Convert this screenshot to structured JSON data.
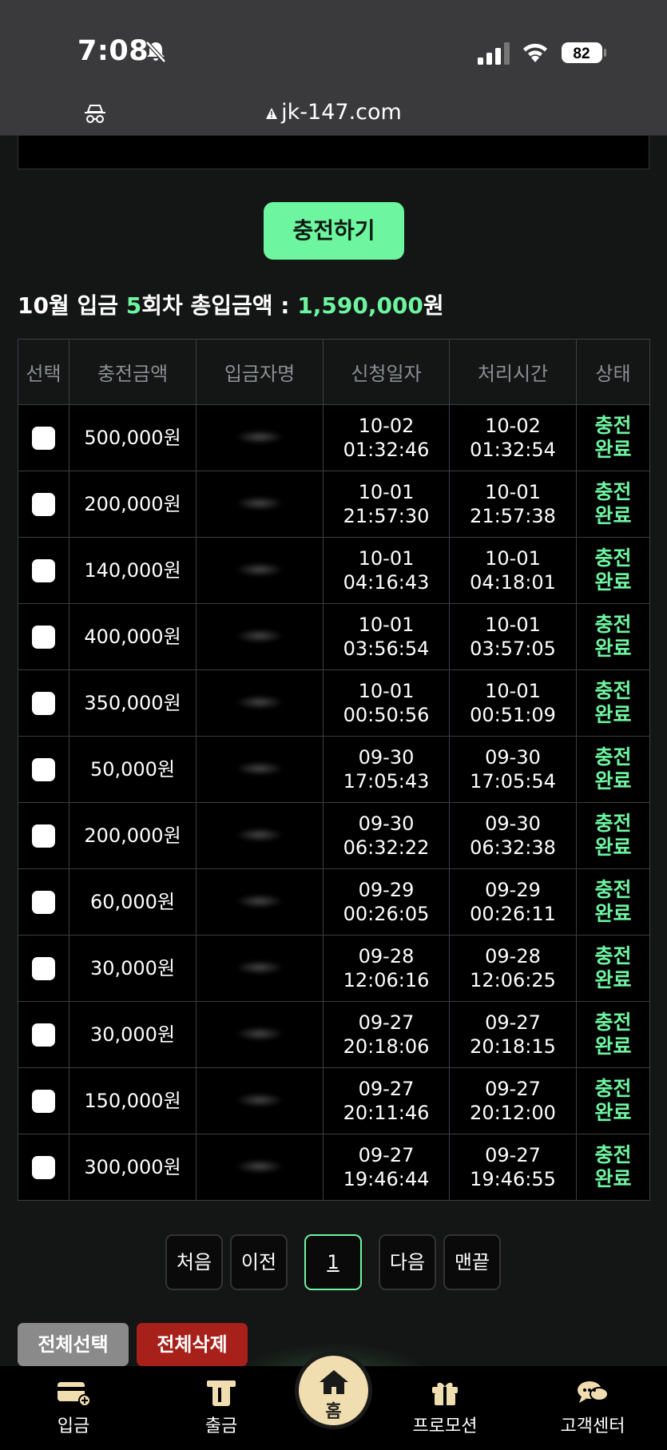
{
  "status_bar": {
    "time": "7:08",
    "battery": "82"
  },
  "browser": {
    "url": "jk-147.com"
  },
  "charge_button": "충전하기",
  "summary": {
    "prefix": "10월 입금 ",
    "count": "5",
    "mid": "회차 총입금액 : ",
    "amount": "1,590,000",
    "suffix": "원"
  },
  "table": {
    "headers": [
      "선택",
      "충전금액",
      "입금자명",
      "신청일자",
      "처리시간",
      "상태"
    ],
    "rows": [
      {
        "amount": "500,000원",
        "req_date": "10-02",
        "req_time": "01:32:46",
        "proc_date": "10-02",
        "proc_time": "01:32:54",
        "status1": "충전",
        "status2": "완료"
      },
      {
        "amount": "200,000원",
        "req_date": "10-01",
        "req_time": "21:57:30",
        "proc_date": "10-01",
        "proc_time": "21:57:38",
        "status1": "충전",
        "status2": "완료"
      },
      {
        "amount": "140,000원",
        "req_date": "10-01",
        "req_time": "04:16:43",
        "proc_date": "10-01",
        "proc_time": "04:18:01",
        "status1": "충전",
        "status2": "완료"
      },
      {
        "amount": "400,000원",
        "req_date": "10-01",
        "req_time": "03:56:54",
        "proc_date": "10-01",
        "proc_time": "03:57:05",
        "status1": "충전",
        "status2": "완료"
      },
      {
        "amount": "350,000원",
        "req_date": "10-01",
        "req_time": "00:50:56",
        "proc_date": "10-01",
        "proc_time": "00:51:09",
        "status1": "충전",
        "status2": "완료"
      },
      {
        "amount": "50,000원",
        "req_date": "09-30",
        "req_time": "17:05:43",
        "proc_date": "09-30",
        "proc_time": "17:05:54",
        "status1": "충전",
        "status2": "완료"
      },
      {
        "amount": "200,000원",
        "req_date": "09-30",
        "req_time": "06:32:22",
        "proc_date": "09-30",
        "proc_time": "06:32:38",
        "status1": "충전",
        "status2": "완료"
      },
      {
        "amount": "60,000원",
        "req_date": "09-29",
        "req_time": "00:26:05",
        "proc_date": "09-29",
        "proc_time": "00:26:11",
        "status1": "충전",
        "status2": "완료"
      },
      {
        "amount": "30,000원",
        "req_date": "09-28",
        "req_time": "12:06:16",
        "proc_date": "09-28",
        "proc_time": "12:06:25",
        "status1": "충전",
        "status2": "완료"
      },
      {
        "amount": "30,000원",
        "req_date": "09-27",
        "req_time": "20:18:06",
        "proc_date": "09-27",
        "proc_time": "20:18:15",
        "status1": "충전",
        "status2": "완료"
      },
      {
        "amount": "150,000원",
        "req_date": "09-27",
        "req_time": "20:11:46",
        "proc_date": "09-27",
        "proc_time": "20:12:00",
        "status1": "충전",
        "status2": "완료"
      },
      {
        "amount": "300,000원",
        "req_date": "09-27",
        "req_time": "19:46:44",
        "proc_date": "09-27",
        "proc_time": "19:46:55",
        "status1": "충전",
        "status2": "완료"
      }
    ]
  },
  "pagination": {
    "first": "처음",
    "prev": "이전",
    "current": "1",
    "next": "다음",
    "last": "맨끝"
  },
  "actions": {
    "select_all": "전체선택",
    "delete_all": "전체삭제"
  },
  "bottom_nav": {
    "deposit": "입금",
    "withdraw": "출금",
    "home": "홈",
    "promotion": "프로모션",
    "support": "고객센터"
  },
  "colors": {
    "accent": "#6ef5a0",
    "delete": "#a8201a",
    "select": "#8a8a8a",
    "home": "#f0deb0"
  }
}
